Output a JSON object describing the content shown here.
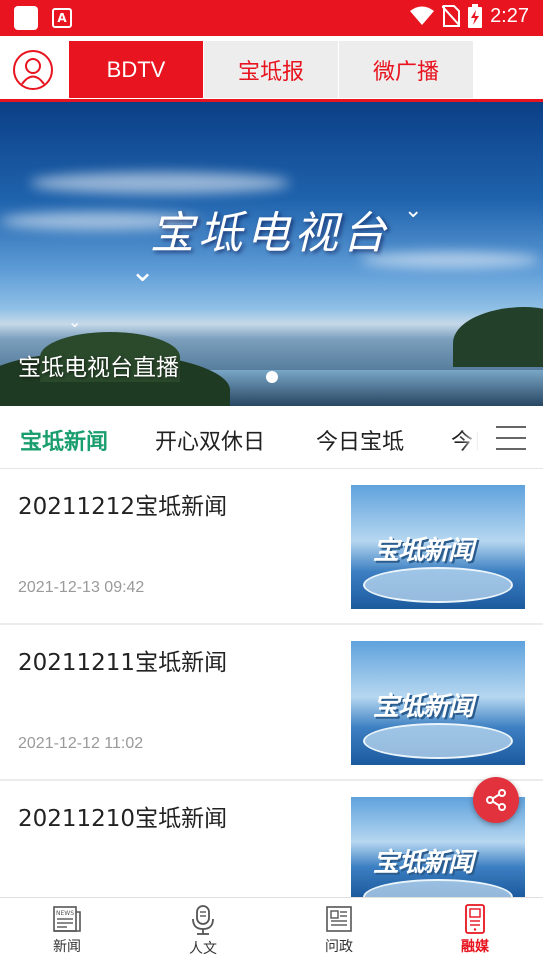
{
  "status_bar": {
    "time": "2:27",
    "notification_icon_letter": "A"
  },
  "header": {
    "tabs": [
      {
        "label": "BDTV",
        "active": true
      },
      {
        "label": "宝坻报",
        "active": false
      },
      {
        "label": "微广播",
        "active": false
      }
    ]
  },
  "banner": {
    "image_title": "宝坻电视台",
    "caption": "宝坻电视台直播"
  },
  "categories": [
    {
      "label": "宝坻新闻",
      "active": true
    },
    {
      "label": "开心双休日",
      "active": false
    },
    {
      "label": "今日宝坻",
      "active": false
    },
    {
      "label": "今日",
      "active": false
    }
  ],
  "news": [
    {
      "title": "20211212宝坻新闻",
      "time": "2021-12-13 09:42",
      "thumb_text": "宝坻新闻"
    },
    {
      "title": "20211211宝坻新闻",
      "time": "2021-12-12 11:02",
      "thumb_text": "宝坻新闻"
    },
    {
      "title": "20211210宝坻新闻",
      "time": "",
      "thumb_text": "宝坻新闻"
    }
  ],
  "bottom_nav": [
    {
      "label": "新闻",
      "icon": "newspaper-icon",
      "active": false
    },
    {
      "label": "人文",
      "icon": "microphone-icon",
      "active": false
    },
    {
      "label": "问政",
      "icon": "document-icon",
      "active": false
    },
    {
      "label": "融媒",
      "icon": "phone-media-icon",
      "active": true
    }
  ],
  "colors": {
    "brand_red": "#e8141f",
    "category_active": "#1a9e6e"
  }
}
